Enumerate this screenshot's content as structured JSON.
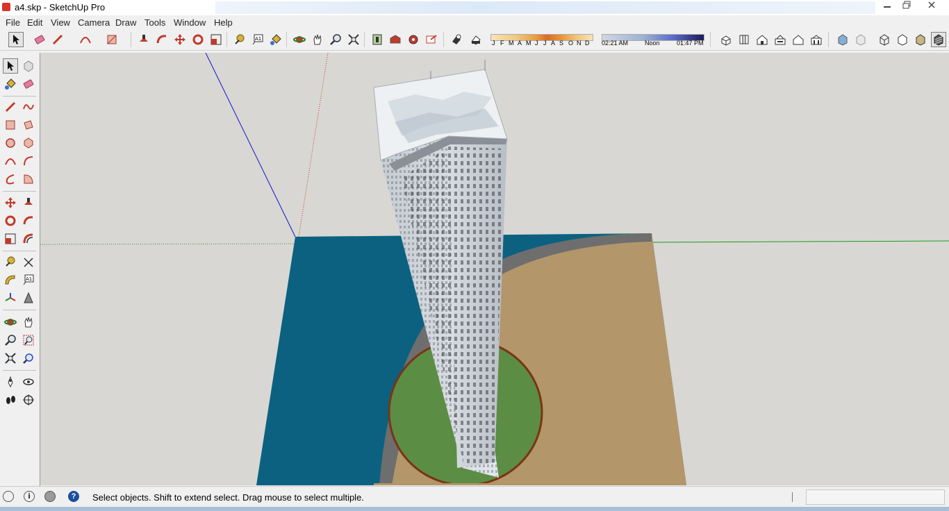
{
  "window": {
    "title": "a4.skp - SketchUp Pro",
    "controls": [
      "minimize",
      "restore",
      "close"
    ]
  },
  "menu": [
    "File",
    "Edit",
    "View",
    "Camera",
    "Draw",
    "Tools",
    "Window",
    "Help"
  ],
  "toolbar": {
    "main_tools": [
      "select-icon",
      "eraser-icon",
      "pencil-icon",
      "arc-icon",
      "rectangle-icon",
      "push-pull-icon",
      "follow-me-icon",
      "move-icon",
      "rotate-icon",
      "scale-icon",
      "tape-measure-icon",
      "text-icon",
      "paint-bucket-icon",
      "orbit-icon",
      "pan-icon",
      "zoom-icon",
      "zoom-extents-icon",
      "section-plane-icon",
      "warehouse-icon",
      "extension-icon",
      "share-icon",
      "shadows-toggle-icon",
      "fog-icon"
    ],
    "shadow_months": [
      "J",
      "F",
      "M",
      "A",
      "M",
      "J",
      "J",
      "A",
      "S",
      "O",
      "N",
      "D"
    ],
    "shadow_time": {
      "start": "02:21 AM",
      "middle": "Noon",
      "end": "01:47 PM"
    },
    "view_tools": [
      "iso-view-icon",
      "top-view-icon",
      "front-view-icon",
      "right-view-icon",
      "back-view-icon",
      "left-view-icon",
      "xray-icon",
      "back-edges-icon",
      "wireframe-icon",
      "hidden-line-icon",
      "shaded-icon",
      "shaded-textures-icon"
    ]
  },
  "left_tools": [
    [
      "select-icon",
      "component-icon"
    ],
    [
      "paint-bucket-icon",
      "eraser-icon"
    ],
    [
      "line-icon",
      "freehand-icon"
    ],
    [
      "rectangle-icon",
      "rotated-rectangle-icon"
    ],
    [
      "circle-icon",
      "polygon-icon"
    ],
    [
      "arc-icon",
      "two-point-arc-icon"
    ],
    [
      "three-point-arc-icon",
      "pie-icon"
    ],
    [
      "move-icon",
      "push-pull-icon"
    ],
    [
      "rotate-icon",
      "follow-me-icon"
    ],
    [
      "scale-icon",
      "offset-icon"
    ],
    [
      "tape-measure-icon",
      "dimension-icon"
    ],
    [
      "protractor-icon",
      "text-icon"
    ],
    [
      "axes-icon",
      "3d-text-icon"
    ],
    [
      "orbit-icon",
      "pan-icon"
    ],
    [
      "zoom-icon",
      "zoom-window-icon"
    ],
    [
      "zoom-extents-icon",
      "previous-view-icon"
    ],
    [
      "position-camera-icon",
      "look-around-icon"
    ],
    [
      "walk-icon",
      "section-plane-icon"
    ]
  ],
  "status": {
    "message": "Select objects. Shift to extend select. Drag mouse to select multiple.",
    "icons": [
      "geo-location-icon",
      "credits-icon",
      "user-icon",
      "help-icon"
    ],
    "measurements": ""
  },
  "colors": {
    "background": "#d8d7d3",
    "water": "#0c6180",
    "ground": "#b3966a",
    "road": "#6e6e6e",
    "lawn": "#5c8d45",
    "tower": "#d9dfe4"
  }
}
